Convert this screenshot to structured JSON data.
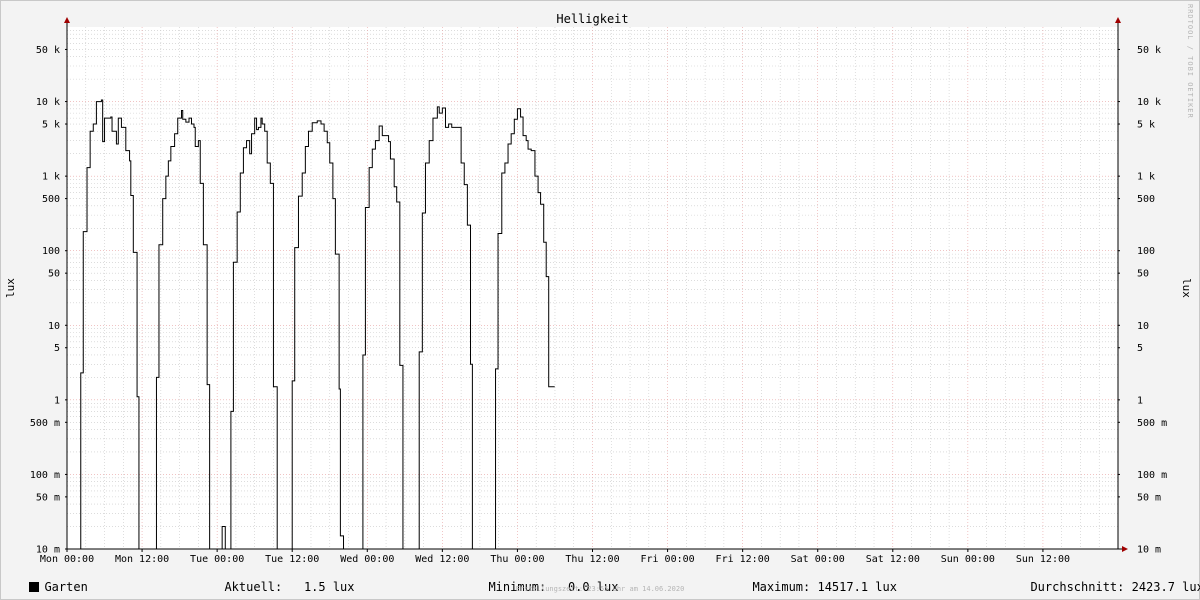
{
  "chart_data": {
    "type": "line",
    "title": "Helligkeit",
    "ylabel": "lux",
    "yscale": "log",
    "ylim": [
      0.01,
      100000
    ],
    "xlim": [
      0,
      168
    ],
    "x_unit": "hours since Mon 00:00",
    "y_ticks": [
      {
        "value": 50000,
        "label": "50 k"
      },
      {
        "value": 10000,
        "label": "10 k"
      },
      {
        "value": 5000,
        "label": "5 k"
      },
      {
        "value": 1000,
        "label": "1 k"
      },
      {
        "value": 500,
        "label": "500"
      },
      {
        "value": 100,
        "label": "100"
      },
      {
        "value": 50,
        "label": "50"
      },
      {
        "value": 10,
        "label": "10"
      },
      {
        "value": 5,
        "label": "5"
      },
      {
        "value": 1,
        "label": "1"
      },
      {
        "value": 0.5,
        "label": "500 m"
      },
      {
        "value": 0.1,
        "label": "100 m"
      },
      {
        "value": 0.05,
        "label": "50 m"
      },
      {
        "value": 0.01,
        "label": "10 m"
      }
    ],
    "x_ticks": [
      {
        "value": 0,
        "label": "Mon 00:00"
      },
      {
        "value": 12,
        "label": "Mon 12:00"
      },
      {
        "value": 24,
        "label": "Tue 00:00"
      },
      {
        "value": 36,
        "label": "Tue 12:00"
      },
      {
        "value": 48,
        "label": "Wed 00:00"
      },
      {
        "value": 60,
        "label": "Wed 12:00"
      },
      {
        "value": 72,
        "label": "Thu 00:00"
      },
      {
        "value": 84,
        "label": "Thu 12:00"
      },
      {
        "value": 96,
        "label": "Fri 00:00"
      },
      {
        "value": 108,
        "label": "Fri 12:00"
      },
      {
        "value": 120,
        "label": "Sat 00:00"
      },
      {
        "value": 132,
        "label": "Sat 12:00"
      },
      {
        "value": 144,
        "label": "Sun 00:00"
      },
      {
        "value": 156,
        "label": "Sun 12:00"
      }
    ],
    "grid": true,
    "series": [
      {
        "name": "Garten",
        "color": "#000000",
        "step": true,
        "points": [
          [
            0,
            0.01
          ],
          [
            2.2,
            2.3
          ],
          [
            2.6,
            180
          ],
          [
            3.2,
            1300
          ],
          [
            3.7,
            4000
          ],
          [
            4.2,
            5000
          ],
          [
            4.7,
            10000
          ],
          [
            5.5,
            10500
          ],
          [
            5.7,
            2900
          ],
          [
            6.0,
            6000
          ],
          [
            7.0,
            6200
          ],
          [
            7.2,
            4000
          ],
          [
            7.7,
            4000
          ],
          [
            7.9,
            2700
          ],
          [
            8.2,
            6000
          ],
          [
            8.6,
            6000
          ],
          [
            8.7,
            4500
          ],
          [
            9.2,
            4500
          ],
          [
            9.4,
            2200
          ],
          [
            10.0,
            1600
          ],
          [
            10.2,
            550
          ],
          [
            10.6,
            95
          ],
          [
            11.2,
            1.1
          ],
          [
            11.5,
            0.01
          ],
          [
            14.3,
            2.0
          ],
          [
            14.7,
            120
          ],
          [
            15.3,
            500
          ],
          [
            15.8,
            1000
          ],
          [
            16.2,
            1600
          ],
          [
            16.6,
            2500
          ],
          [
            17.2,
            3700
          ],
          [
            17.7,
            6000
          ],
          [
            18.3,
            7600
          ],
          [
            18.5,
            5800
          ],
          [
            19.0,
            5300
          ],
          [
            19.5,
            6000
          ],
          [
            19.9,
            5000
          ],
          [
            20.3,
            4500
          ],
          [
            20.5,
            2500
          ],
          [
            21.0,
            3000
          ],
          [
            21.3,
            800
          ],
          [
            21.8,
            120
          ],
          [
            22.4,
            1.6
          ],
          [
            22.8,
            0.01
          ],
          [
            24.8,
            0.02
          ],
          [
            25.3,
            0.01
          ],
          [
            26.2,
            0.7
          ],
          [
            26.6,
            70
          ],
          [
            27.2,
            330
          ],
          [
            27.7,
            1100
          ],
          [
            28.2,
            2400
          ],
          [
            28.7,
            3000
          ],
          [
            29.2,
            2000
          ],
          [
            29.5,
            3700
          ],
          [
            30.0,
            6000
          ],
          [
            30.3,
            4200
          ],
          [
            30.6,
            4500
          ],
          [
            31.0,
            6000
          ],
          [
            31.2,
            5000
          ],
          [
            31.6,
            4000
          ],
          [
            32.0,
            1500
          ],
          [
            32.5,
            800
          ],
          [
            33.0,
            1.5
          ],
          [
            33.6,
            0.01
          ],
          [
            36.0,
            1.8
          ],
          [
            36.4,
            110
          ],
          [
            37.0,
            540
          ],
          [
            37.6,
            1100
          ],
          [
            38.1,
            2500
          ],
          [
            38.6,
            4000
          ],
          [
            39.2,
            5200
          ],
          [
            40.0,
            5500
          ],
          [
            40.6,
            5000
          ],
          [
            41.1,
            4000
          ],
          [
            41.6,
            2800
          ],
          [
            42.0,
            1500
          ],
          [
            42.5,
            500
          ],
          [
            42.9,
            90
          ],
          [
            43.5,
            1.4
          ],
          [
            43.7,
            0.015
          ],
          [
            44.2,
            0.01
          ],
          [
            47.3,
            4.0
          ],
          [
            47.7,
            380
          ],
          [
            48.3,
            1300
          ],
          [
            48.8,
            2300
          ],
          [
            49.3,
            3000
          ],
          [
            49.9,
            4700
          ],
          [
            50.4,
            3500
          ],
          [
            51.0,
            3500
          ],
          [
            51.4,
            2900
          ],
          [
            51.7,
            1700
          ],
          [
            52.3,
            720
          ],
          [
            52.7,
            450
          ],
          [
            53.2,
            2.9
          ],
          [
            53.7,
            0.01
          ],
          [
            56.3,
            4.4
          ],
          [
            56.8,
            320
          ],
          [
            57.3,
            1500
          ],
          [
            57.9,
            3000
          ],
          [
            58.5,
            6000
          ],
          [
            59.2,
            8500
          ],
          [
            59.5,
            7000
          ],
          [
            60.0,
            8200
          ],
          [
            60.5,
            4500
          ],
          [
            61.0,
            5000
          ],
          [
            61.5,
            4500
          ],
          [
            62.3,
            4500
          ],
          [
            63.0,
            1500
          ],
          [
            63.5,
            770
          ],
          [
            64.0,
            220
          ],
          [
            64.5,
            3.0
          ],
          [
            64.8,
            0.01
          ],
          [
            68.5,
            2.6
          ],
          [
            68.9,
            170
          ],
          [
            69.5,
            1100
          ],
          [
            70.0,
            1500
          ],
          [
            70.5,
            2700
          ],
          [
            71.0,
            3700
          ],
          [
            71.5,
            5800
          ],
          [
            72.0,
            8000
          ],
          [
            72.5,
            6200
          ],
          [
            72.9,
            3500
          ],
          [
            73.4,
            3000
          ],
          [
            73.7,
            2300
          ],
          [
            74.2,
            2200
          ],
          [
            74.8,
            1000
          ],
          [
            75.3,
            600
          ],
          [
            75.7,
            420
          ],
          [
            76.2,
            130
          ],
          [
            76.6,
            45
          ],
          [
            77.0,
            1.5
          ]
        ]
      }
    ],
    "legend": {
      "name": "Garten",
      "aktuell_label": "Aktuell:",
      "aktuell_value": "1.5 lux",
      "minimum_label": "Minimum:",
      "minimum_value": "0.0 lux",
      "maximum_label": "Maximum:",
      "maximum_value": "14517.1 lux",
      "durchschnitt_label": "Durchschnitt:",
      "durchschnitt_value": "2423.7 lux"
    },
    "footer": "Erstellungszeit: 23:55 Uhr am 14.06.2020",
    "watermark": "RRDTOOL / TOBI OETIKER",
    "colors": {
      "background": "#f3f3f3",
      "plot": "#ffffff",
      "grid_major": "#e8a0a0",
      "grid_minor": "#c8c8c8",
      "line": "#000000",
      "arrow": "#a00000"
    }
  }
}
